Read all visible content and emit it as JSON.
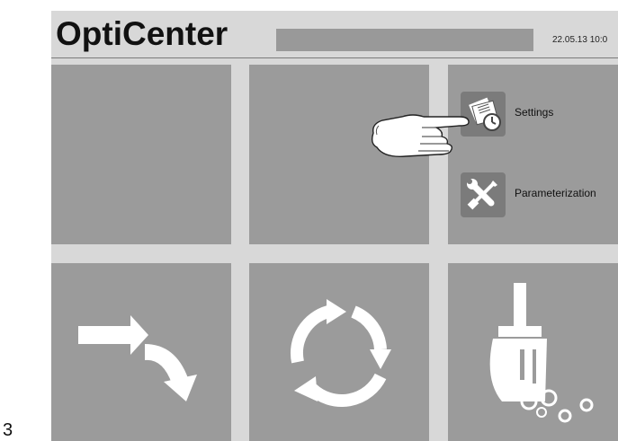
{
  "page": {
    "page_number": "3"
  },
  "header": {
    "title": "OptiCenter",
    "datetime": "22.05.13 10:0"
  },
  "menu": {
    "settings_label": "Settings",
    "parameterization_label": "Parameterization"
  },
  "tiles": {
    "top_left_icon": "",
    "top_middle_icon": "",
    "top_right_icons": [
      "settings-icon",
      "parameterization-icon"
    ],
    "bottom_left_icon": "curved-arrow-icon",
    "bottom_middle_icon": "cycle-arrows-icon",
    "bottom_right_icon": "broom-icon"
  },
  "colors": {
    "screen_bg": "#d8d8d8",
    "tile_bg": "#9b9b9b",
    "status_bar": "#999999",
    "icon_bg": "#7b7b7b",
    "icon_fg": "#ffffff"
  },
  "icons": {
    "pointer": "pointing-hand-icon"
  }
}
